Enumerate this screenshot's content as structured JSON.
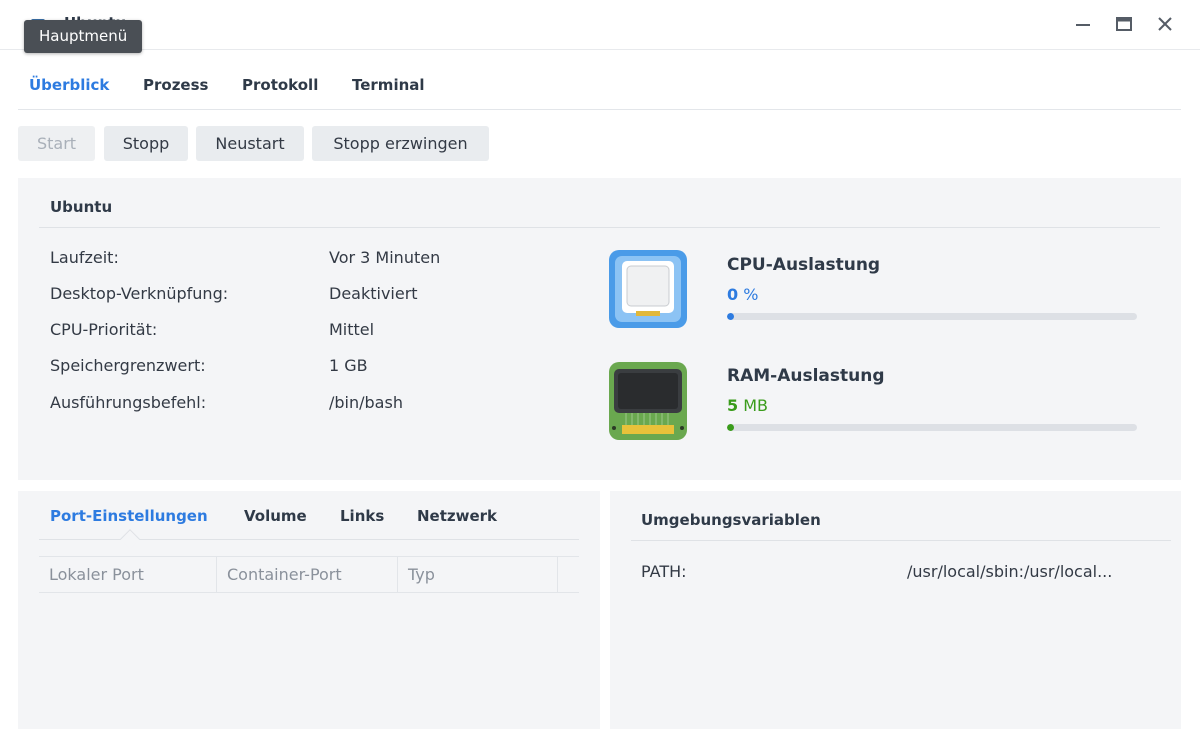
{
  "window": {
    "title": "Ubuntu",
    "tooltip": "Hauptmenü"
  },
  "tabs": [
    {
      "label": "Überblick",
      "active": true
    },
    {
      "label": "Prozess",
      "active": false
    },
    {
      "label": "Protokoll",
      "active": false
    },
    {
      "label": "Terminal",
      "active": false
    }
  ],
  "toolbar": {
    "start_label": "Start",
    "stop_label": "Stopp",
    "restart_label": "Neustart",
    "force_stop_label": "Stopp erzwingen"
  },
  "overview": {
    "title": "Ubuntu",
    "rows": [
      {
        "label": "Laufzeit:",
        "value": "Vor 3 Minuten"
      },
      {
        "label": "Desktop-Verknüpfung:",
        "value": "Deaktiviert"
      },
      {
        "label": "CPU-Priorität:",
        "value": "Mittel"
      },
      {
        "label": "Speichergrenzwert:",
        "value": "1 GB"
      },
      {
        "label": "Ausführungsbefehl:",
        "value": "/bin/bash"
      }
    ],
    "cpu": {
      "title": "CPU-Auslastung",
      "number": "0",
      "unit": "%",
      "usage_fraction": 0.0,
      "color": "#2d7be0",
      "icon": "cpu-chip-icon"
    },
    "ram": {
      "title": "RAM-Auslastung",
      "number": "5",
      "unit": "MB",
      "usage_fraction": 0.005,
      "color": "#3a9c1b",
      "icon": "ram-module-icon"
    }
  },
  "ports": {
    "tabs": [
      {
        "label": "Port-Einstellungen",
        "active": true
      },
      {
        "label": "Volume",
        "active": false
      },
      {
        "label": "Links",
        "active": false
      },
      {
        "label": "Netzwerk",
        "active": false
      }
    ],
    "columns": [
      "Lokaler Port",
      "Container-Port",
      "Typ"
    ]
  },
  "env": {
    "title": "Umgebungsvariablen",
    "rows": [
      {
        "key": "PATH:",
        "value": "/usr/local/sbin:/usr/local..."
      }
    ]
  },
  "colors": {
    "accent": "#2d7be0",
    "ram_green": "#3a9c1b"
  }
}
